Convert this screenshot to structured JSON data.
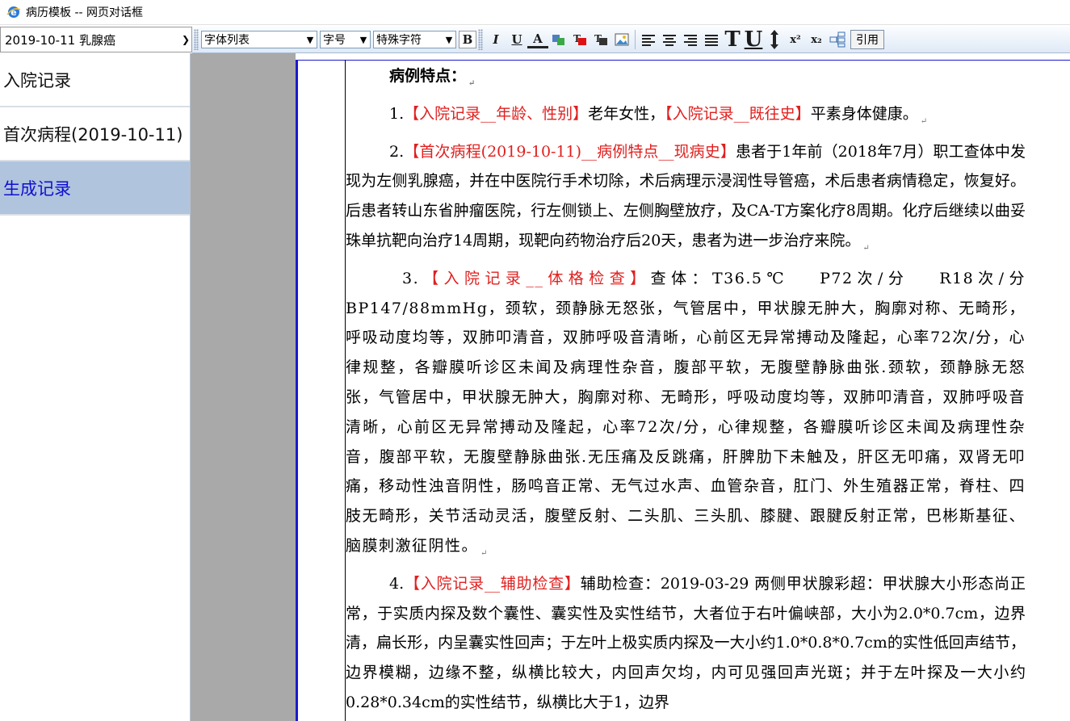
{
  "window": {
    "title": "病历模板 -- 网页对话框"
  },
  "record_select": {
    "value": "2019-10-11 乳腺癌"
  },
  "toolbar": {
    "font_list": "字体列表",
    "font_size": "字号",
    "special_chars": "特殊字符",
    "bold": "B",
    "italic": "I",
    "underline": "U",
    "font_color": "A",
    "big_t": "T",
    "big_u": "U",
    "superscript": "x²",
    "subscript": "x₂",
    "cite": "引用"
  },
  "nav": {
    "items": [
      {
        "label": "入院记录"
      },
      {
        "label": "首次病程(2019-10-11)"
      },
      {
        "label": "生成记录"
      }
    ]
  },
  "doc": {
    "heading": "病例特点：",
    "p1": {
      "num": "1.",
      "tag1": "【入院记录__年龄、性别】",
      "text1": "老年女性，",
      "tag2": "【入院记录__既往史】",
      "text2": "平素身体健康。"
    },
    "p2": {
      "num": "2.",
      "tag": "【首次病程(2019-10-11)__病例特点__现病史】",
      "text": "患者于1年前（2018年7月）职工查体中发现为左侧乳腺癌，并在中医院行手术切除，术后病理示浸润性导管癌，术后患者病情稳定，恢复好。后患者转山东省肿瘤医院，行左侧锁上、左侧胸壁放疗，及CA-T方案化疗8周期。化疗后继续以曲妥珠单抗靶向治疗14周期，现靶向药物治疗后20天，患者为进一步治疗来院。"
    },
    "p3": {
      "num": "3.",
      "tag": "【入院记录__体格检查】",
      "text": "查体：T36.5℃　 P72次/分　 R18次/分　BP147/88mmHg，颈软，颈静脉无怒张，气管居中，甲状腺无肿大，胸廓对称、无畸形，呼吸动度均等，双肺叩清音，双肺呼吸音清晰，心前区无异常搏动及隆起，心率72次/分，心律规整，各瓣膜听诊区未闻及病理性杂音，腹部平软，无腹壁静脉曲张.颈软，颈静脉无怒张，气管居中，甲状腺无肿大，胸廓对称、无畸形，呼吸动度均等，双肺叩清音，双肺呼吸音清晰，心前区无异常搏动及隆起，心率72次/分，心律规整，各瓣膜听诊区未闻及病理性杂音，腹部平软，无腹壁静脉曲张.无压痛及反跳痛，肝脾肋下未触及，肝区无叩痛，双肾无叩痛，移动性浊音阴性，肠鸣音正常、无气过水声、血管杂音，肛门、外生殖器正常，脊柱、四肢无畸形，关节活动灵活，腹壁反射、二头肌、三头肌、膝腱、跟腱反射正常，巴彬斯基征、脑膜刺激征阴性。"
    },
    "p4": {
      "num": "4.",
      "tag": "【入院记录__辅助检查】",
      "text": "辅助检查：2019-03-29 两侧甲状腺彩超：甲状腺大小形态尚正常，于实质内探及数个囊性、囊实性及实性结节，大者位于右叶偏峡部，大小为2.0*0.7cm，边界清，扁长形，内呈囊实性回声；于左叶上极实质内探及一大小约1.0*0.8*0.7cm的实性低回声结节，边界模糊，边缘不整，纵横比较大，内回声欠均，内可见强回声光斑；并于左叶探及一大小约0.28*0.34cm的实性结节，纵横比大于1，边界"
    }
  },
  "colors": {
    "tag_red": "#e0201f",
    "nav_active_bg": "#b0c4de",
    "nav_active_text": "#1010d0"
  }
}
